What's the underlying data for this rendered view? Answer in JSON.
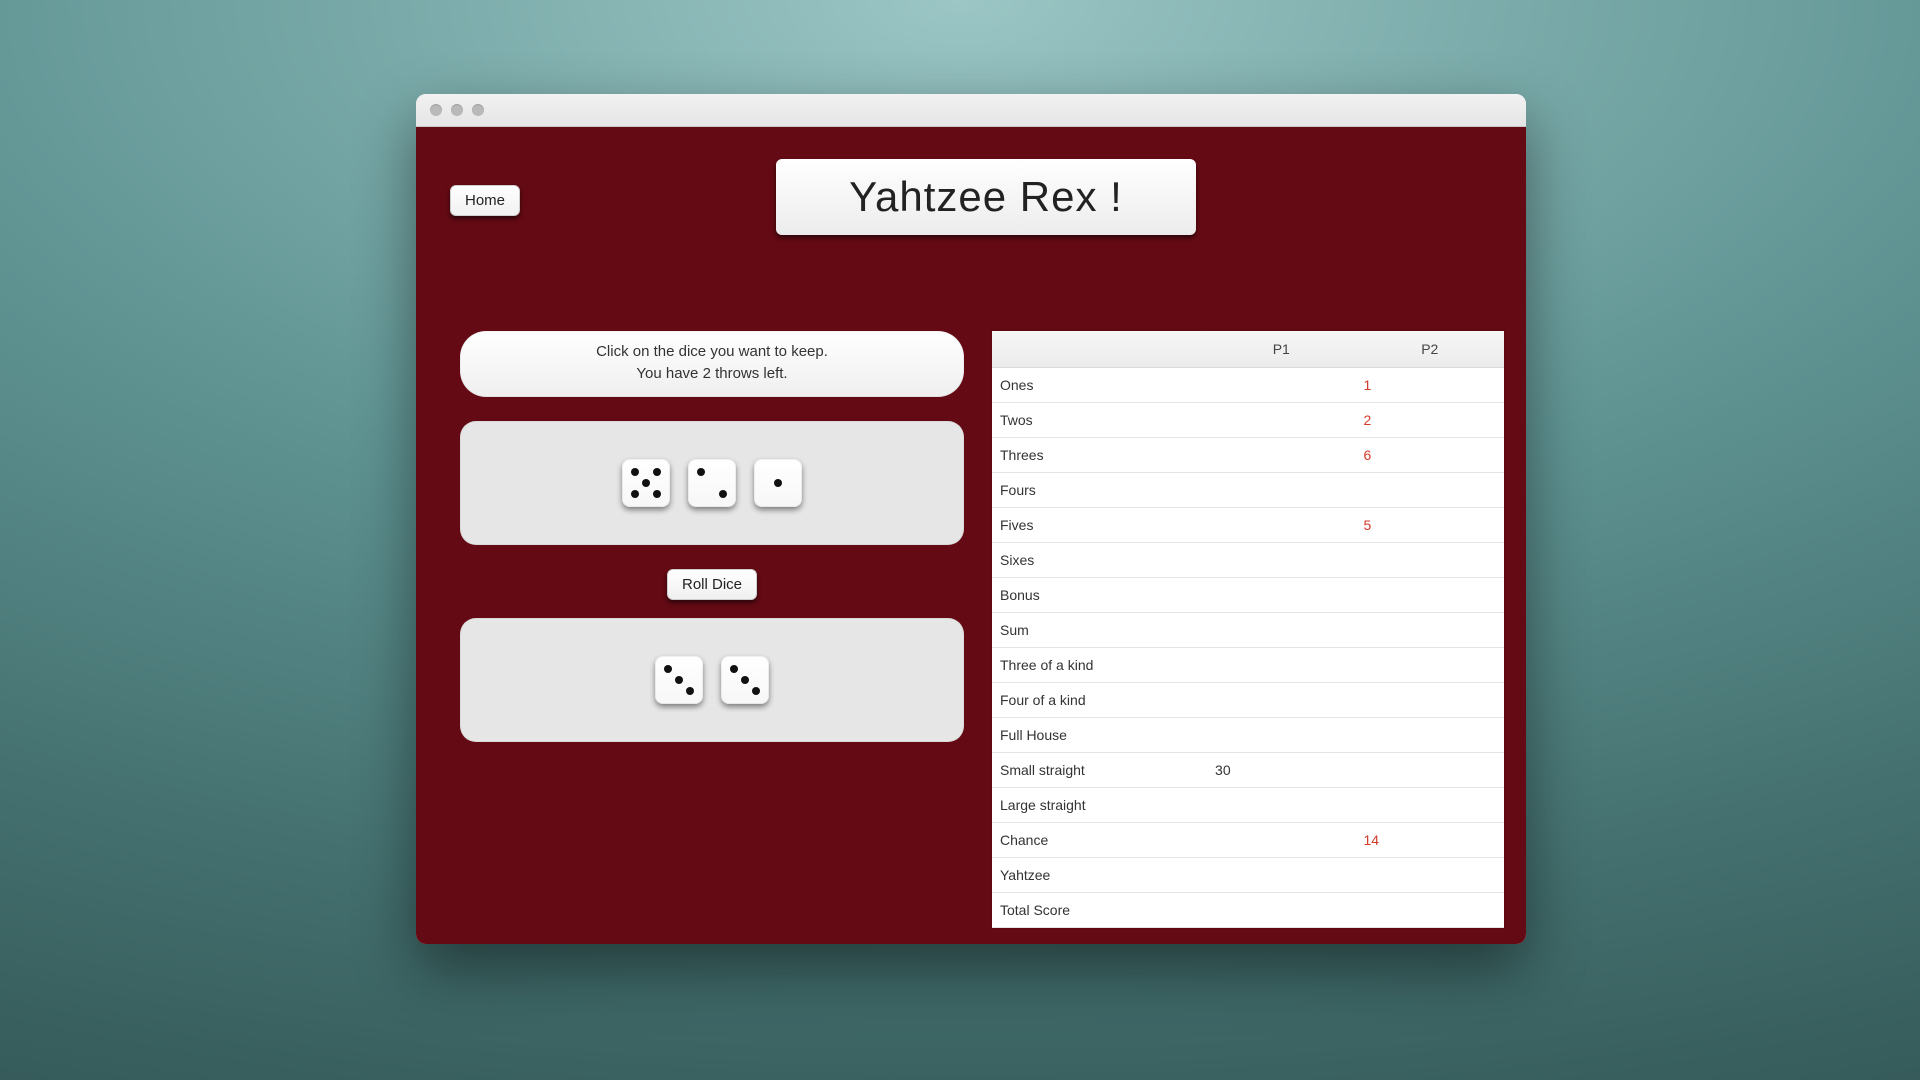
{
  "window": {
    "title": "Yahtzee Rex !"
  },
  "header": {
    "home_label": "Home",
    "title": "Yahtzee Rex !"
  },
  "message": {
    "line1": "Click on the dice you want to keep.",
    "line2": "You have 2 throws left."
  },
  "buttons": {
    "roll_label": "Roll Dice"
  },
  "dice": {
    "rolled": [
      5,
      2,
      1
    ],
    "kept": [
      3,
      3
    ]
  },
  "score": {
    "headers": [
      "",
      "P1",
      "P2"
    ],
    "rows": [
      {
        "label": "Ones",
        "p1": "",
        "p2": "1",
        "p2_red": true
      },
      {
        "label": "Twos",
        "p1": "",
        "p2": "2",
        "p2_red": true
      },
      {
        "label": "Threes",
        "p1": "",
        "p2": "6",
        "p2_red": true
      },
      {
        "label": "Fours",
        "p1": "",
        "p2": ""
      },
      {
        "label": "Fives",
        "p1": "",
        "p2": "5",
        "p2_red": true
      },
      {
        "label": "Sixes",
        "p1": "",
        "p2": ""
      },
      {
        "label": "Bonus",
        "p1": "",
        "p2": ""
      },
      {
        "label": "Sum",
        "p1": "",
        "p2": ""
      },
      {
        "label": "Three of a kind",
        "p1": "",
        "p2": ""
      },
      {
        "label": "Four of a kind",
        "p1": "",
        "p2": ""
      },
      {
        "label": "Full House",
        "p1": "",
        "p2": ""
      },
      {
        "label": "Small straight",
        "p1": "30",
        "p2": ""
      },
      {
        "label": "Large straight",
        "p1": "",
        "p2": ""
      },
      {
        "label": "Chance",
        "p1": "",
        "p2": "14",
        "p2_red": true
      },
      {
        "label": "Yahtzee",
        "p1": "",
        "p2": ""
      },
      {
        "label": "Total Score",
        "p1": "",
        "p2": ""
      }
    ]
  }
}
